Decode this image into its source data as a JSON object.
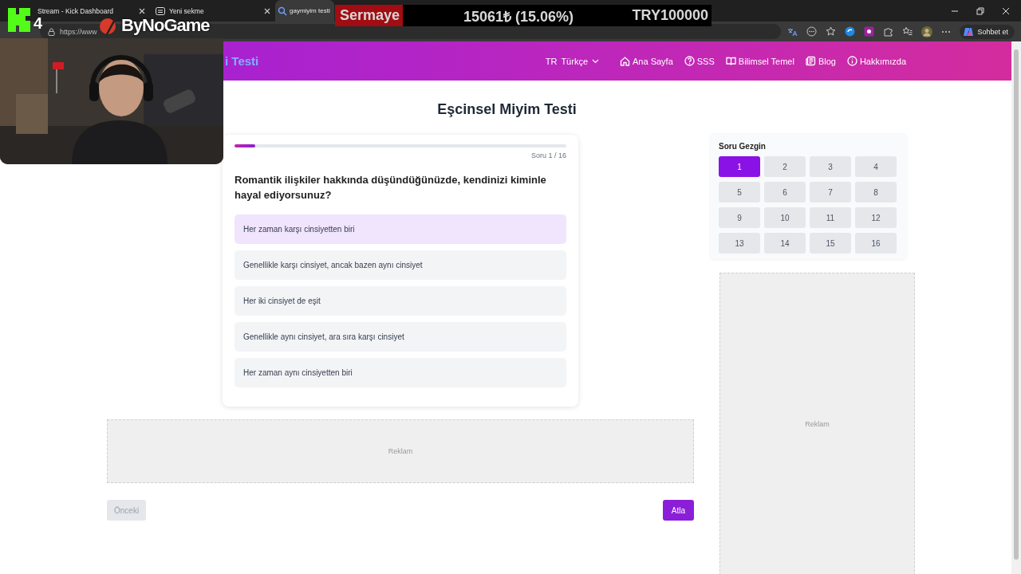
{
  "browser": {
    "tabs": [
      {
        "title": "Stream - Kick Dashboard",
        "selected": false
      },
      {
        "title": "Yeni sekme",
        "selected": false
      },
      {
        "title": "gaymiyim testi",
        "selected": true
      }
    ],
    "url": "https://www",
    "assistant_label": "Sohbet et"
  },
  "site": {
    "brand": "i Testi",
    "language": {
      "code": "TR",
      "label": "Türkçe"
    },
    "nav": [
      {
        "label": "Ana Sayfa"
      },
      {
        "label": "SSS"
      },
      {
        "label": "Bilimsel Temel"
      },
      {
        "label": "Blog"
      },
      {
        "label": "Hakkımızda"
      }
    ]
  },
  "quiz": {
    "title": "Eşcinsel Miyim Testi",
    "progress": {
      "level": 0.0625,
      "label": "Soru 1 / 16"
    },
    "question": "Romantik ilişkiler hakkında düşündüğünüzde, kendinizi kiminle hayal ediyorsunuz?",
    "options": [
      {
        "text": "Her zaman karşı cinsiyetten biri",
        "highlighted": true
      },
      {
        "text": "Genellikle karşı cinsiyet, ancak bazen aynı cinsiyet",
        "highlighted": false
      },
      {
        "text": "Her iki cinsiyet de eşit",
        "highlighted": false
      },
      {
        "text": "Genellikle aynı cinsiyet, ara sıra karşı cinsiyet",
        "highlighted": false
      },
      {
        "text": "Her zaman aynı cinsiyetten biri",
        "highlighted": false
      }
    ],
    "ad": {
      "label": "Reklam"
    },
    "buttons": {
      "previous": {
        "label": "Önceki",
        "disabled": true
      },
      "skip": {
        "label": "Atla",
        "disabled": false
      }
    }
  },
  "navigator": {
    "title": "Soru Gezgin",
    "questions": [
      {
        "label": "1",
        "selected": true
      },
      {
        "label": "2",
        "selected": false
      },
      {
        "label": "3",
        "selected": false
      },
      {
        "label": "4",
        "selected": false
      },
      {
        "label": "5",
        "selected": false
      },
      {
        "label": "6",
        "selected": false
      },
      {
        "label": "7",
        "selected": false
      },
      {
        "label": "8",
        "selected": false
      },
      {
        "label": "9",
        "selected": false
      },
      {
        "label": "10",
        "selected": false
      },
      {
        "label": "11",
        "selected": false
      },
      {
        "label": "12",
        "selected": false
      },
      {
        "label": "13",
        "selected": false
      },
      {
        "label": "14",
        "selected": false
      },
      {
        "label": "15",
        "selected": false
      },
      {
        "label": "16",
        "selected": false
      }
    ]
  },
  "side_ad": {
    "label": "Reklam"
  },
  "overlay": {
    "channel_number": "4",
    "sponsor": "ByNoGame",
    "ticker": {
      "title": "Sermaye",
      "change": "15061₺ (15.06%)",
      "target": "TRY100000"
    }
  }
}
